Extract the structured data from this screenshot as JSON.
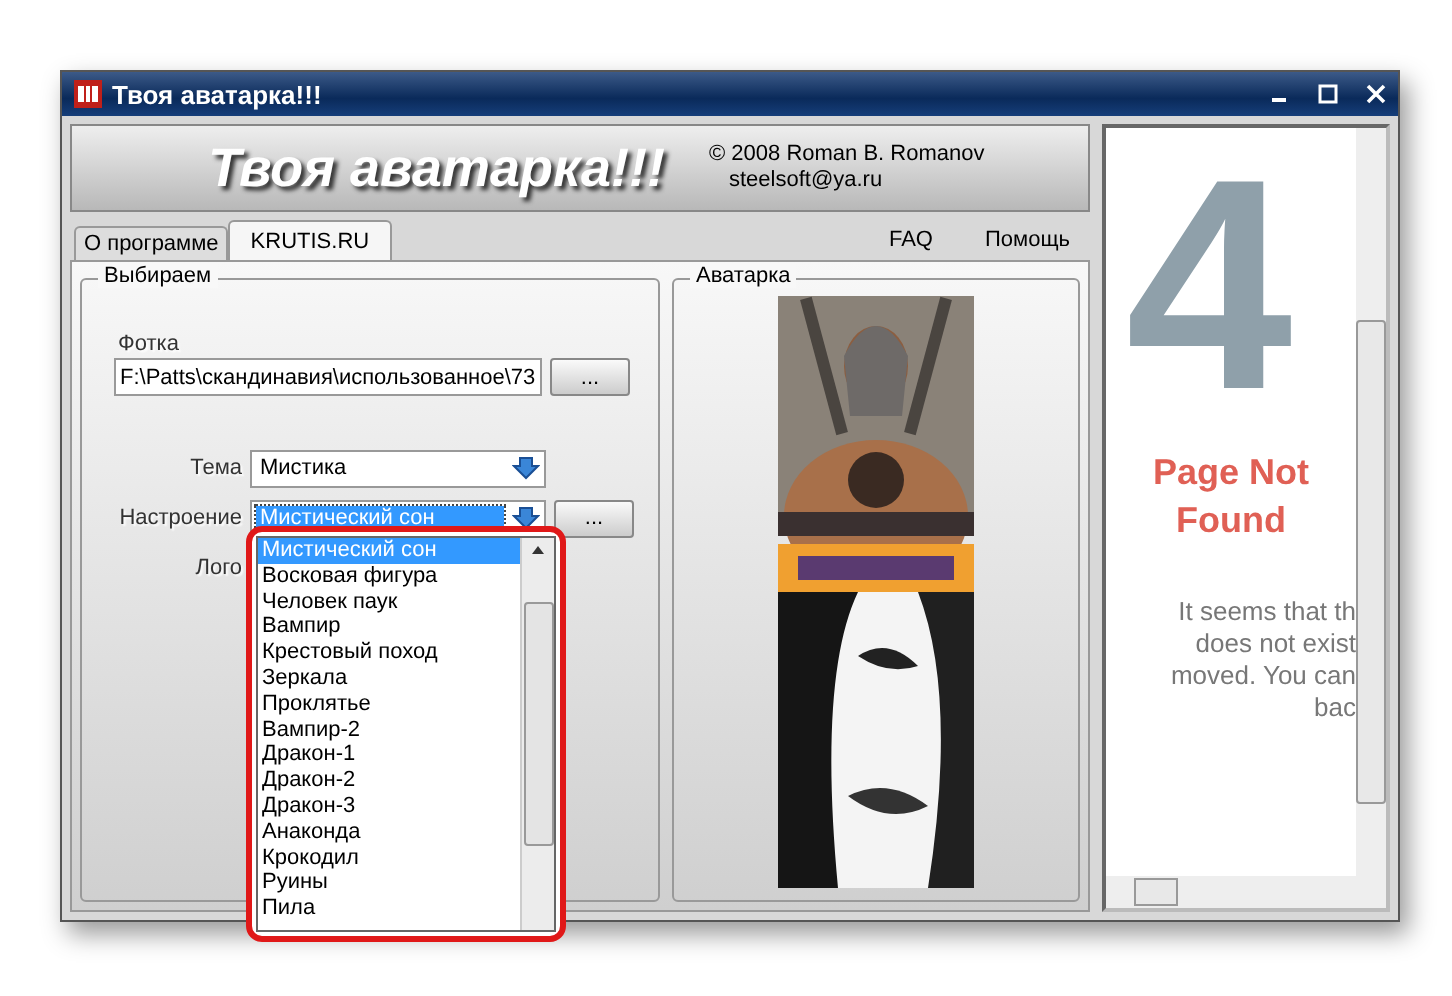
{
  "window": {
    "title": "Твоя аватарка!!!"
  },
  "header": {
    "title": "Твоя аватарка!!!",
    "copyright": "© 2008 Roman B. Romanov",
    "email": "steelsoft@ya.ru"
  },
  "tabs": [
    {
      "label": "О программе",
      "selected": false
    },
    {
      "label": "KRUTIS.RU",
      "selected": true
    }
  ],
  "links": [
    "FAQ",
    "Помощь"
  ],
  "chooser": {
    "title": "Выбираем",
    "photo": {
      "label": "Фотка",
      "value": "F:\\Patts\\скандинавия\\использованное\\73",
      "button": "..."
    },
    "theme": {
      "label": "Тема",
      "value": "Мистика"
    },
    "mood": {
      "label": "Настроение",
      "value": "Мистический сон",
      "button": "..."
    },
    "logo": {
      "label": "Лого"
    },
    "dropdown": [
      {
        "label": "Мистический сон",
        "selected": true
      },
      {
        "label": "Восковая фигура",
        "selected": false
      },
      {
        "label": "Человек паук",
        "selected": false
      },
      {
        "label": "Вампир",
        "selected": false
      },
      {
        "label": "Крестовый поход",
        "selected": false
      },
      {
        "label": "Зеркала",
        "selected": false
      },
      {
        "label": "Проклятье",
        "selected": false
      },
      {
        "label": "Вампир-2",
        "selected": false
      },
      {
        "label": "Дракон-1",
        "selected": false
      },
      {
        "label": "Дракон-2",
        "selected": false
      },
      {
        "label": "Дракон-3",
        "selected": false
      },
      {
        "label": "Анаконда",
        "selected": false
      },
      {
        "label": "Крокодил",
        "selected": false
      },
      {
        "label": "Руины",
        "selected": false
      },
      {
        "label": "Пила",
        "selected": false
      }
    ]
  },
  "avatar": {
    "title": "Аватарка",
    "kind": "picture"
  },
  "browser": {
    "big_digit": "4",
    "heading": "Page Not Found",
    "message_lines": [
      "It seems that th",
      "does not exist",
      "moved. You can",
      "bac"
    ]
  }
}
